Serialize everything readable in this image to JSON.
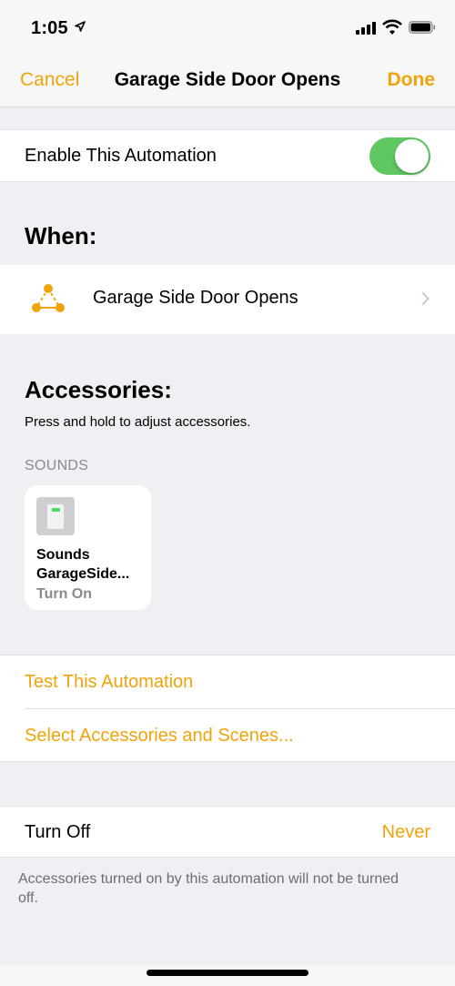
{
  "status_bar": {
    "time": "1:05"
  },
  "nav": {
    "cancel_label": "Cancel",
    "title": "Garage Side Door Opens",
    "done_label": "Done"
  },
  "enable": {
    "label": "Enable This Automation",
    "on": true
  },
  "when": {
    "title": "When:",
    "trigger_label": "Garage Side Door Opens",
    "trigger_icon": "automation-trigger-icon"
  },
  "accessories": {
    "title": "Accessories:",
    "subtitle": "Press and hold to adjust accessories.",
    "group_header": "SOUNDS",
    "tiles": [
      {
        "name_line1": "Sounds",
        "name_line2": "GarageSide...",
        "status": "Turn On"
      }
    ]
  },
  "actions": {
    "test_label": "Test This Automation",
    "select_label": "Select Accessories and Scenes..."
  },
  "turn_off": {
    "label": "Turn Off",
    "value": "Never"
  },
  "footer": {
    "note": "Accessories turned on by this automation will not be turned off."
  },
  "colors": {
    "accent": "#f0a30a",
    "toggle_on": "#5fc862",
    "background": "#efeff4"
  }
}
